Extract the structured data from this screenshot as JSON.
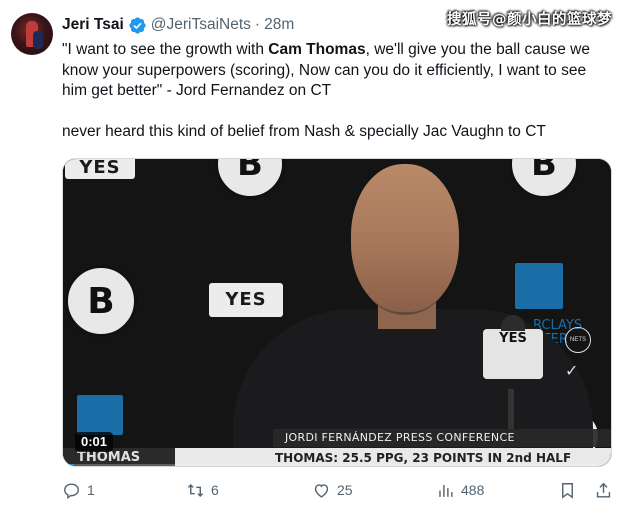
{
  "author": {
    "display_name": "Jeri Tsai",
    "handle": "@JeriTsaiNets",
    "time": "28m",
    "verified_color": "#1d9bf0"
  },
  "watermark": "搜狐号@颜小白的篮球梦",
  "tweet": {
    "line1_pre": "\"I want to see the growth with ",
    "line1_bold": "Cam Thomas",
    "line1_post": ", we'll give you the ball cause we know your superpowers (scoring), Now can you do it efficiently, I want to see him get better\" - Jord Fernandez on CT",
    "line2": "never heard this kind of belief from Nash & specially Jac Vaughn to CT"
  },
  "video": {
    "timestamp": "0:01",
    "progress": 0.02,
    "lower_third": "JORDI FERNÁNDEZ PRESS CONFERENCE",
    "ticker_left": "THOMAS",
    "ticker_text": "THOMAS: 25.5 PPG, 23 POINTS IN 2nd HALF",
    "mic_label": "YES",
    "yes_logo": "YES",
    "nets_badge": "NETS",
    "bank_text_1": "RCLAYS",
    "bank_text_2": "NTER"
  },
  "actions": {
    "replies": "1",
    "reposts": "6",
    "likes": "25",
    "views": "488"
  },
  "colors": {
    "text_primary": "#0f1419",
    "text_secondary": "#536471",
    "accent": "#1d9bf0"
  }
}
